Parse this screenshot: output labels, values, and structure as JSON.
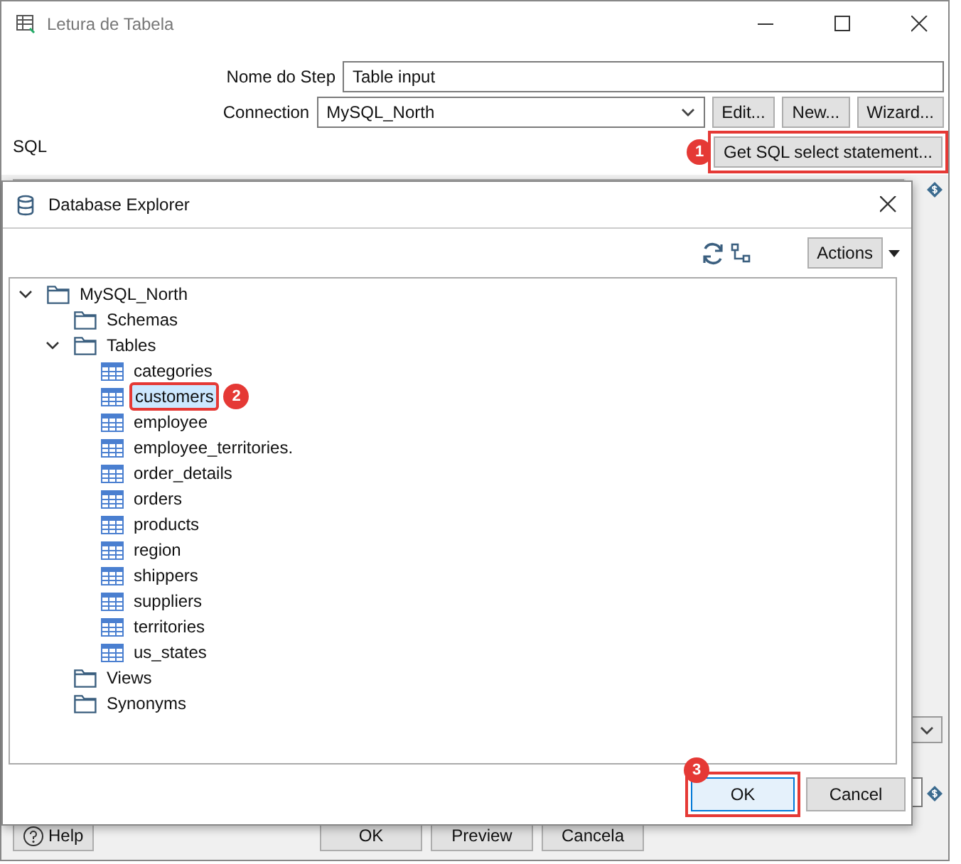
{
  "window": {
    "title": "Letura de Tabela"
  },
  "form": {
    "step_label": "Nome do Step",
    "step_value": "Table input",
    "connection_label": "Connection",
    "connection_value": "MySQL_North",
    "buttons": [
      "Edit...",
      "New...",
      "Wizard..."
    ],
    "sql_label": "SQL",
    "get_sql_button": {
      "label": "Get SQL select statement...",
      "marker": "1"
    }
  },
  "dialog": {
    "title": "Database Explorer",
    "actions_button": "Actions",
    "tree": [
      {
        "label": "MySQL_North",
        "kind": "folder",
        "expanded": true,
        "selected": false,
        "children": [
          {
            "label": "Schemas",
            "kind": "folder",
            "selected": false
          },
          {
            "label": "Tables",
            "kind": "folder",
            "expanded": true,
            "selected": false,
            "children": [
              {
                "label": "categories",
                "kind": "table",
                "selected": false
              },
              {
                "label": "customers",
                "kind": "table",
                "selected": true,
                "marker": "2"
              },
              {
                "label": "employee",
                "kind": "table",
                "selected": false
              },
              {
                "label": "employee_territories.",
                "kind": "table",
                "selected": false
              },
              {
                "label": "order_details",
                "kind": "table",
                "selected": false
              },
              {
                "label": "orders",
                "kind": "table",
                "selected": false
              },
              {
                "label": "products",
                "kind": "table",
                "selected": false
              },
              {
                "label": "region",
                "kind": "table",
                "selected": false
              },
              {
                "label": "shippers",
                "kind": "table",
                "selected": false
              },
              {
                "label": "suppliers",
                "kind": "table",
                "selected": false
              },
              {
                "label": "territories",
                "kind": "table",
                "selected": false
              },
              {
                "label": "us_states",
                "kind": "table",
                "selected": false
              }
            ]
          },
          {
            "label": "Views",
            "kind": "folder",
            "selected": false
          },
          {
            "label": "Synonyms",
            "kind": "folder",
            "selected": false
          }
        ]
      }
    ],
    "ok_button": {
      "label": "OK",
      "marker": "3"
    },
    "cancel_button": "Cancel"
  },
  "bottom_buttons": {
    "help": "Help",
    "ok": "OK",
    "preview": "Preview",
    "cancel": "Cancela"
  }
}
